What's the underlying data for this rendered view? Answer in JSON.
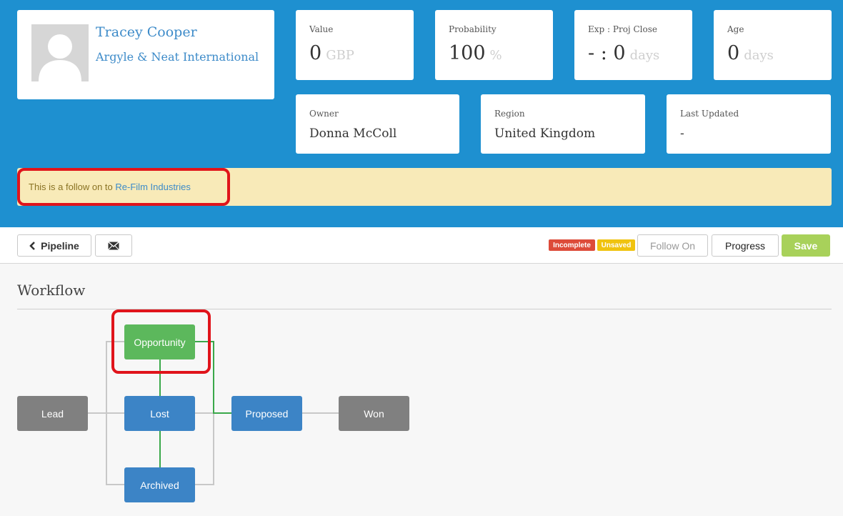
{
  "contact": {
    "name": "Tracey Cooper",
    "company": "Argyle & Neat International"
  },
  "stats": [
    {
      "label": "Value",
      "value": "0",
      "unit": "GBP"
    },
    {
      "label": "Probability",
      "value": "100",
      "unit": "%"
    },
    {
      "label": "Exp : Proj Close",
      "value": "- : 0",
      "unit": "days"
    },
    {
      "label": "Age",
      "value": "0",
      "unit": "days"
    }
  ],
  "info": [
    {
      "label": "Owner",
      "value": "Donna McColl"
    },
    {
      "label": "Region",
      "value": "United Kingdom"
    },
    {
      "label": "Last Updated",
      "value": "-"
    }
  ],
  "notice": {
    "prefix": "This is a follow on to",
    "link": "Re-Film Industries"
  },
  "toolbar": {
    "pipeline_label": "Pipeline",
    "badge_incomplete": "Incomplete",
    "badge_unsaved": "Unsaved",
    "follow_on_label": "Follow On",
    "progress_label": "Progress",
    "save_label": "Save"
  },
  "workflow": {
    "title": "Workflow",
    "nodes": {
      "opportunity": "Opportunity",
      "lead": "Lead",
      "lost": "Lost",
      "proposed": "Proposed",
      "won": "Won",
      "archived": "Archived"
    }
  },
  "colors": {
    "header": "#1e90d0",
    "notice": "#f8eab8",
    "node_grey": "#808080",
    "node_blue": "#3c84c6",
    "node_green": "#5cb85c",
    "highlight": "#e0141b",
    "save": "#a8d15a"
  },
  "icons": {
    "pipeline": "chevron-left-icon",
    "mail": "envelope-icon",
    "avatar": "user-silhouette-icon"
  }
}
